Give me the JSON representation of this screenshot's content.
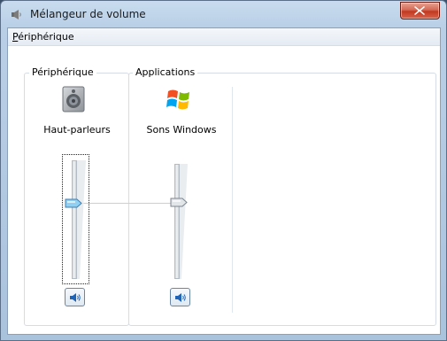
{
  "window": {
    "title": "Mélangeur de volume"
  },
  "menu": {
    "items": [
      "Périphérique"
    ]
  },
  "device_group": {
    "label": "Périphérique",
    "device_name": "Haut-parleurs",
    "device_icon": "speaker-icon",
    "volume_level": 0.55
  },
  "apps_group": {
    "label": "Applications",
    "apps": [
      {
        "name": "Sons Windows",
        "icon": "windows-logo-icon",
        "volume_level": 0.55
      }
    ]
  },
  "colors": {
    "titlebar": "#b9cfe6",
    "close_button": "#c0391f",
    "device_thumb": "#7ec2ea",
    "app_thumb": "#d4d8dc"
  }
}
